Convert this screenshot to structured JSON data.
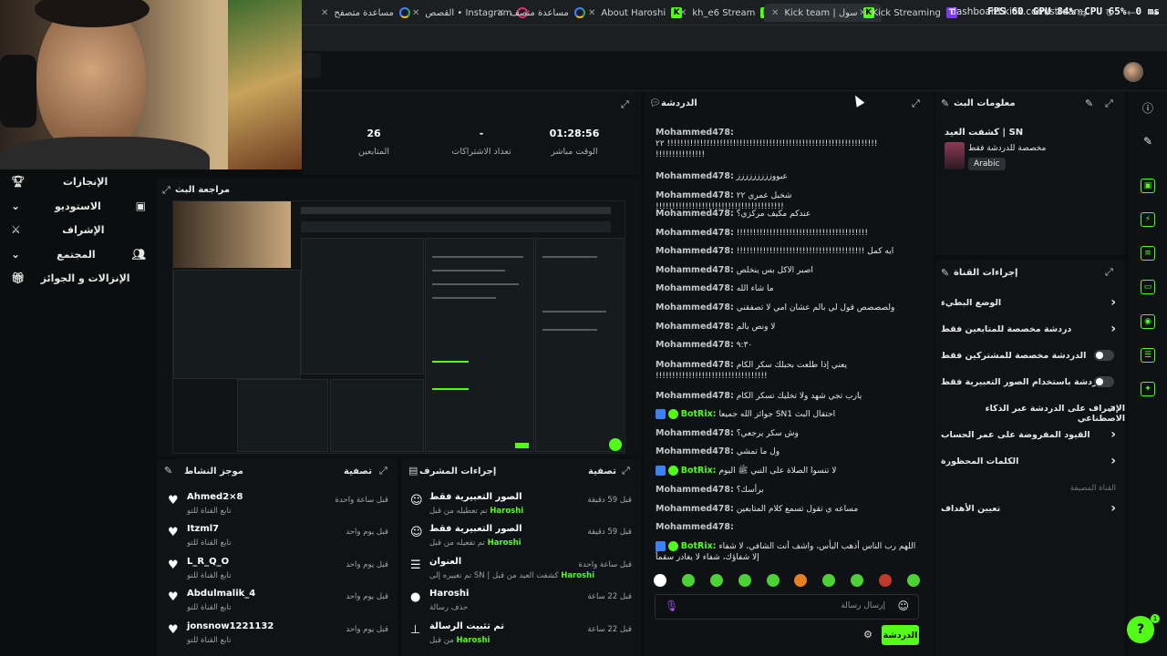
{
  "browser": {
    "tabs": [
      {
        "label": "مساعدة متصفح",
        "icon": "google-icon"
      },
      {
        "label": "القصص • Instagram",
        "icon": "instagram-icon"
      },
      {
        "label": "مساعدة متصف",
        "icon": "google-icon"
      },
      {
        "label": "About Haroshi",
        "icon": "kick-icon"
      },
      {
        "label": "kh_e6 Stream",
        "icon": "kick-icon"
      },
      {
        "label": "Kick team | سول",
        "icon": "kick-icon"
      },
      {
        "label": "Kick Streaming",
        "icon": "twitch-icon"
      }
    ],
    "stats_overlay": {
      "fps": "FPS 60",
      "gpu": "GPU 84%",
      "cpu": "CPU 65%",
      "ping": "0 ms"
    },
    "url": "dashboard.kick.com/stream"
  },
  "sidebar": {
    "items": [
      {
        "label": "الإنجازات",
        "icon": "trophy-icon"
      },
      {
        "label": "الاستوديو",
        "icon": "studio-icon"
      },
      {
        "label": "الإشراف",
        "icon": "sword-icon"
      },
      {
        "label": "المجتمع",
        "icon": "community-icon"
      },
      {
        "label": "الإنزالات و الجوائز",
        "icon": "gift-icon"
      }
    ]
  },
  "stream_stats": [
    {
      "value": "01:28:56",
      "label": "الوقت مباشر"
    },
    {
      "value": "-",
      "label": "تعداد الاشتراكات"
    },
    {
      "value": "26",
      "label": "المتابعين"
    }
  ],
  "preview": {
    "title": "مراجعة البث"
  },
  "activity": {
    "title": "موجز النشاط",
    "filter": "تصفية",
    "items": [
      {
        "name": "Ahmed2×8",
        "desc": "تابع القناة للتو",
        "time": "قبل ساعة واحدة"
      },
      {
        "name": "Itzml7",
        "desc": "تابع القناة للتو",
        "time": "قبل يوم واحد"
      },
      {
        "name": "L_R_Q_O",
        "desc": "تابع القناة للتو",
        "time": "قبل يوم واحد"
      },
      {
        "name": "Abdulmalik_4",
        "desc": "تابع القناة للتو",
        "time": "قبل يوم واحد"
      },
      {
        "name": "jonsnow1221132",
        "desc": "تابع القناة للتو",
        "time": "قبل يوم واحد"
      }
    ]
  },
  "mod_actions": {
    "title": "إجراءات المشرف",
    "filter": "تصفية",
    "items": [
      {
        "title": "الصور التعبيرية فقط",
        "desc_pre": "تم تعطيله من قبل",
        "user": "Haroshi",
        "time": "قبل 59 دقيقة",
        "icon": "smiley-icon"
      },
      {
        "title": "الصور التعبيرية فقط",
        "desc_pre": "تم تفعيله من قبل",
        "user": "Haroshi",
        "time": "قبل 59 دقيقة",
        "icon": "smiley-icon"
      },
      {
        "title": "العنوان",
        "desc_pre": "تم تغييره إلى SN | كشفت العيد من قبل",
        "user": "Haroshi",
        "time": "قبل ساعة واحدة",
        "icon": "title-icon"
      },
      {
        "title": "Haroshi",
        "desc_pre": "حذف رسالة",
        "user": "",
        "time": "قبل 22 ساعة",
        "icon": "user-icon"
      },
      {
        "title": "تم تثبيت الرسالة",
        "desc_pre": "من قبل",
        "user": "Haroshi",
        "time": "قبل 22 ساعة",
        "icon": "pin-icon"
      }
    ]
  },
  "chat": {
    "title": "الدردشة",
    "messages": [
      {
        "user": "Mohammed478:",
        "text": "!!!!!!!!!!!!!!!!!!!!!!!!!!!!!!!!!!!!!!!!!!!!!!!!!!!!!!!!!!!!!!!! ٢٢ !!!!!!!!!!!!!!!",
        "bot": false
      },
      {
        "user": "Mohammed478:",
        "text": "عبووززززززززز",
        "bot": false
      },
      {
        "user": "Mohammed478:",
        "text": "شخبل عمري ٢٢ !!!!!!!!!!!!!!!!!!!!!!!!!!!!!!!!!!!!!!!",
        "bot": false
      },
      {
        "user": "Mohammed478:",
        "text": "عندكم مكيف مركزي؟",
        "bot": false
      },
      {
        "user": "Mohammed478:",
        "text": "!!!!!!!!!!!!!!!!!!!!!!!!!!!!!!!!!!!!!!!!",
        "bot": false
      },
      {
        "user": "Mohammed478:",
        "text": "ايه كمل !!!!!!!!!!!!!!!!!!!!!!!!!!!!!!!!!!!!!!!",
        "bot": false
      },
      {
        "user": "Mohammed478:",
        "text": "اصبر الاكل بس ينخلص",
        "bot": false
      },
      {
        "user": "Mohammed478:",
        "text": "ما شاء الله",
        "bot": false
      },
      {
        "user": "Mohammed478:",
        "text": "ولصصصص قول لي بالم عشان امي لا تصفقني",
        "bot": false
      },
      {
        "user": "Mohammed478:",
        "text": "لا ونص بالم",
        "bot": false
      },
      {
        "user": "Mohammed478:",
        "text": "٩:٣٠",
        "bot": false
      },
      {
        "user": "Mohammed478:",
        "text": "يعني إذا طلعت بحبلك سكر الكام !!!!!!!!!!!!!!!!!!!!!!!!!!!!!!!!!!",
        "bot": false
      },
      {
        "user": "Mohammed478:",
        "text": "يارب تجي شهد ولا تخليك تسكر الكام",
        "bot": false
      },
      {
        "user": "BotRix:",
        "text": "احتفال البث SN1 جوائز الله جميعا",
        "bot": true
      },
      {
        "user": "Mohammed478:",
        "text": "وش سكر يرجعي؟",
        "bot": false
      },
      {
        "user": "Mohammed478:",
        "text": "ول ما تمشي",
        "bot": false
      },
      {
        "user": "BotRix:",
        "text": "لا تنسوا الصلاة على النبي ﷺ اليوم",
        "bot": true
      },
      {
        "user": "Mohammed478:",
        "text": "برأسك؟",
        "bot": false
      },
      {
        "user": "Mohammed478:",
        "text": "مساعه ي تقول تسمع كلام المتابعين",
        "bot": false
      },
      {
        "user": "Mohammed478:",
        "text": "",
        "bot": false
      },
      {
        "user": "BotRix:",
        "text": "اللهم رب الناس أذهب البأس، واشف أنت الشافي، لا شفاء إلا شفاؤك، شفاء لا يغادر سقماً",
        "bot": true
      }
    ],
    "input_placeholder": "إرسال رسالة",
    "send_label": "الدردشة"
  },
  "stream_info": {
    "title": "معلومات البث",
    "stream_title": "كشفت العيد | SN",
    "chat_mode": "مخصصة للدردشة فقط",
    "language": "Arabic"
  },
  "channel_actions": {
    "title": "إجراءات القناة",
    "items": [
      {
        "label": "الوضع البطيء",
        "kind": "chevron"
      },
      {
        "label": "دردشة مخصصة للمتابعين فقط",
        "kind": "chevron"
      },
      {
        "label": "الدردشة مخصصة للمشتركين فقط",
        "kind": "toggle"
      },
      {
        "label": "الدردشة باستخدام الصور التعبيرية فقط",
        "kind": "toggle"
      },
      {
        "label": "الإشراف على الدردشة عبر الذكاء الاصطناعي",
        "kind": "link"
      },
      {
        "label": "القيود المفروضة على عمر الحساب",
        "kind": "chevron"
      },
      {
        "label": "الكلمات المحظورة",
        "kind": "chevron"
      },
      {
        "label": "القناة المضيفة",
        "kind": "muted"
      },
      {
        "label": "تعيين الأهداف",
        "kind": "chevron"
      }
    ]
  },
  "help_badge": "1",
  "accent_color": "#53fc18"
}
